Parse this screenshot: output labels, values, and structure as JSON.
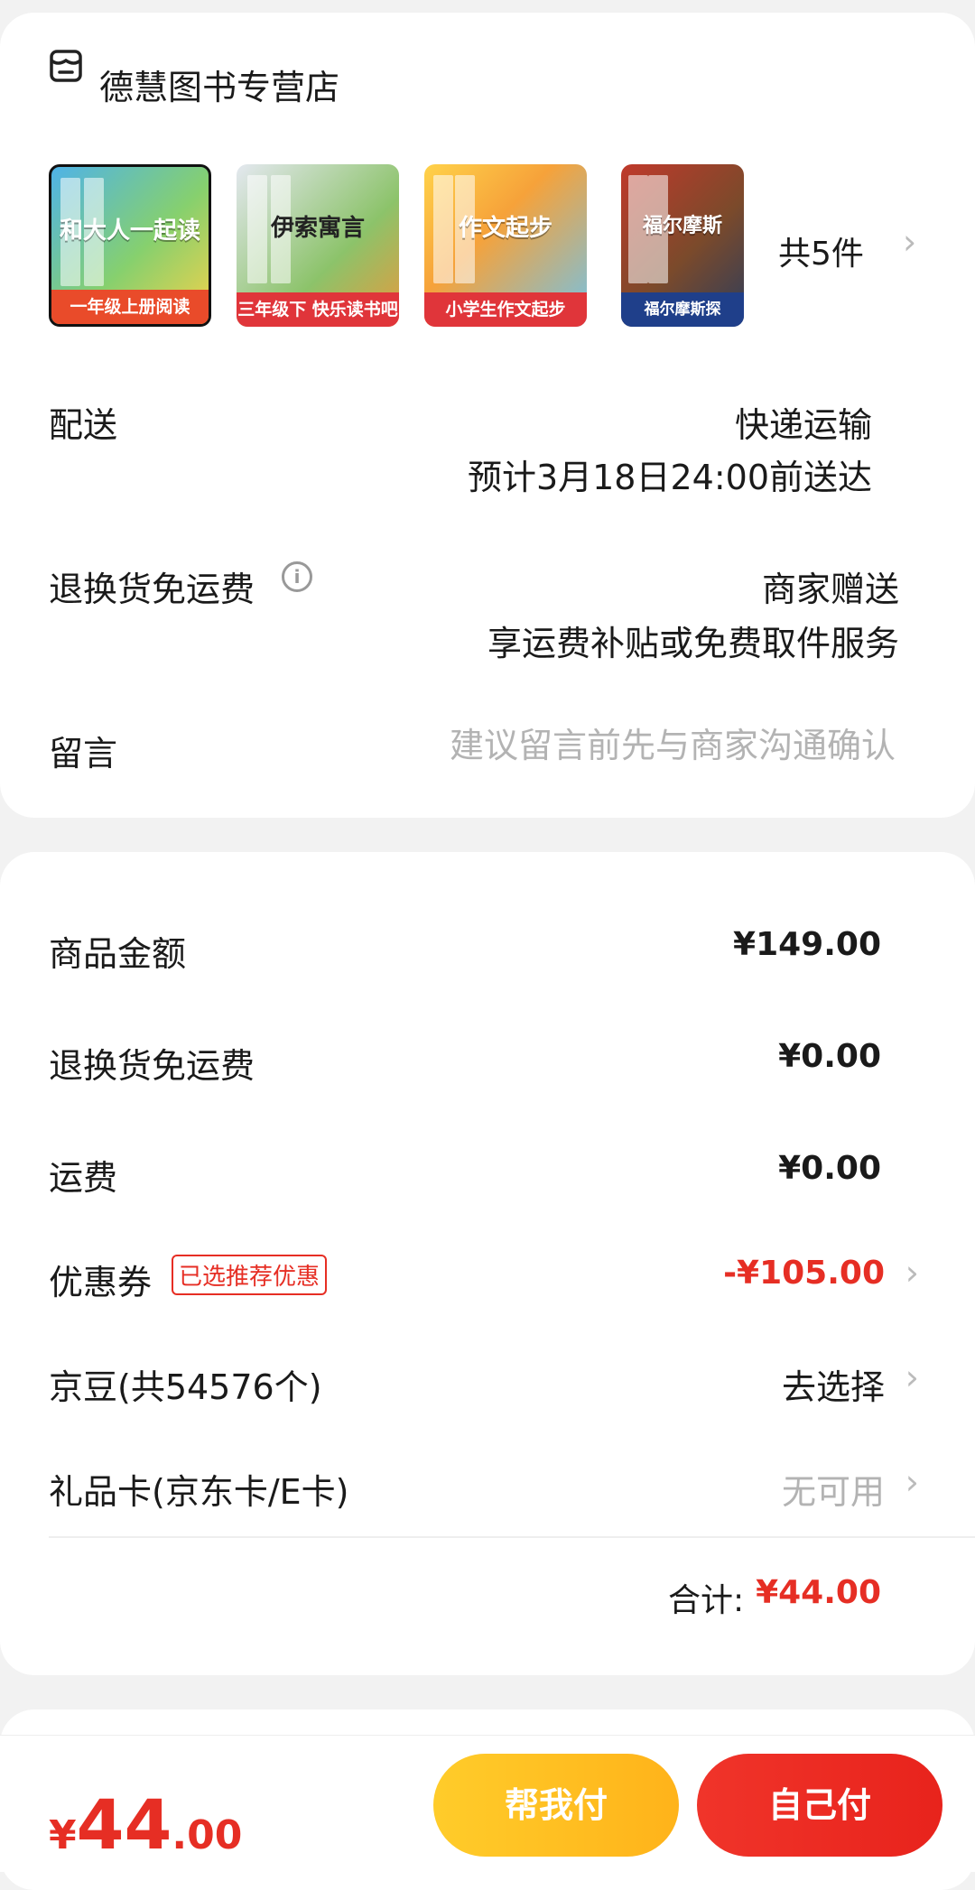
{
  "store": {
    "name": "德慧图书专营店",
    "icon": "store-icon"
  },
  "products": {
    "items": [
      {
        "tag": "一年级上册阅读",
        "title": "和大人一起读"
      },
      {
        "tag": "三年级下 快乐读书吧",
        "title": "伊索寓言"
      },
      {
        "tag": "小学生作文起步",
        "title": "作文起步"
      },
      {
        "tag": "福尔摩斯探",
        "title": "福尔摩斯"
      }
    ],
    "count_label": "共5件",
    "chevron": "›"
  },
  "delivery": {
    "label": "配送",
    "method": "快递运输",
    "eta": "预计3月18日24:00前送达"
  },
  "return_shipping": {
    "label": "退换货免运费",
    "info_icon": "ⓘ",
    "value": "商家赠送",
    "desc": "享运费补贴或免费取件服务"
  },
  "note": {
    "label": "留言",
    "placeholder": "建议留言前先与商家沟通确认"
  },
  "price": {
    "goods_label": "商品金额",
    "goods_value": "¥149.00",
    "return_label": "退换货免运费",
    "return_value": "¥0.00",
    "shipping_label": "运费",
    "shipping_value": "¥0.00",
    "coupon_label": "优惠券",
    "coupon_badge": "已选推荐优惠",
    "coupon_value": "-¥105.00",
    "beans_label": "京豆(共54576个)",
    "beans_value": "去选择",
    "giftcard_label": "礼品卡(京东卡/E卡)",
    "giftcard_value": "无可用",
    "chevron": "›",
    "total_label": "合计:",
    "total_value": "¥44.00"
  },
  "bottom_bar": {
    "currency": "¥",
    "amount_int": "44",
    "amount_dec": ".00",
    "help_pay": "帮我付",
    "self_pay": "自己付"
  },
  "colors": {
    "accent_red": "#e62e24",
    "help_pay_yellow": "#ffc020",
    "background": "#f2f2f2"
  }
}
